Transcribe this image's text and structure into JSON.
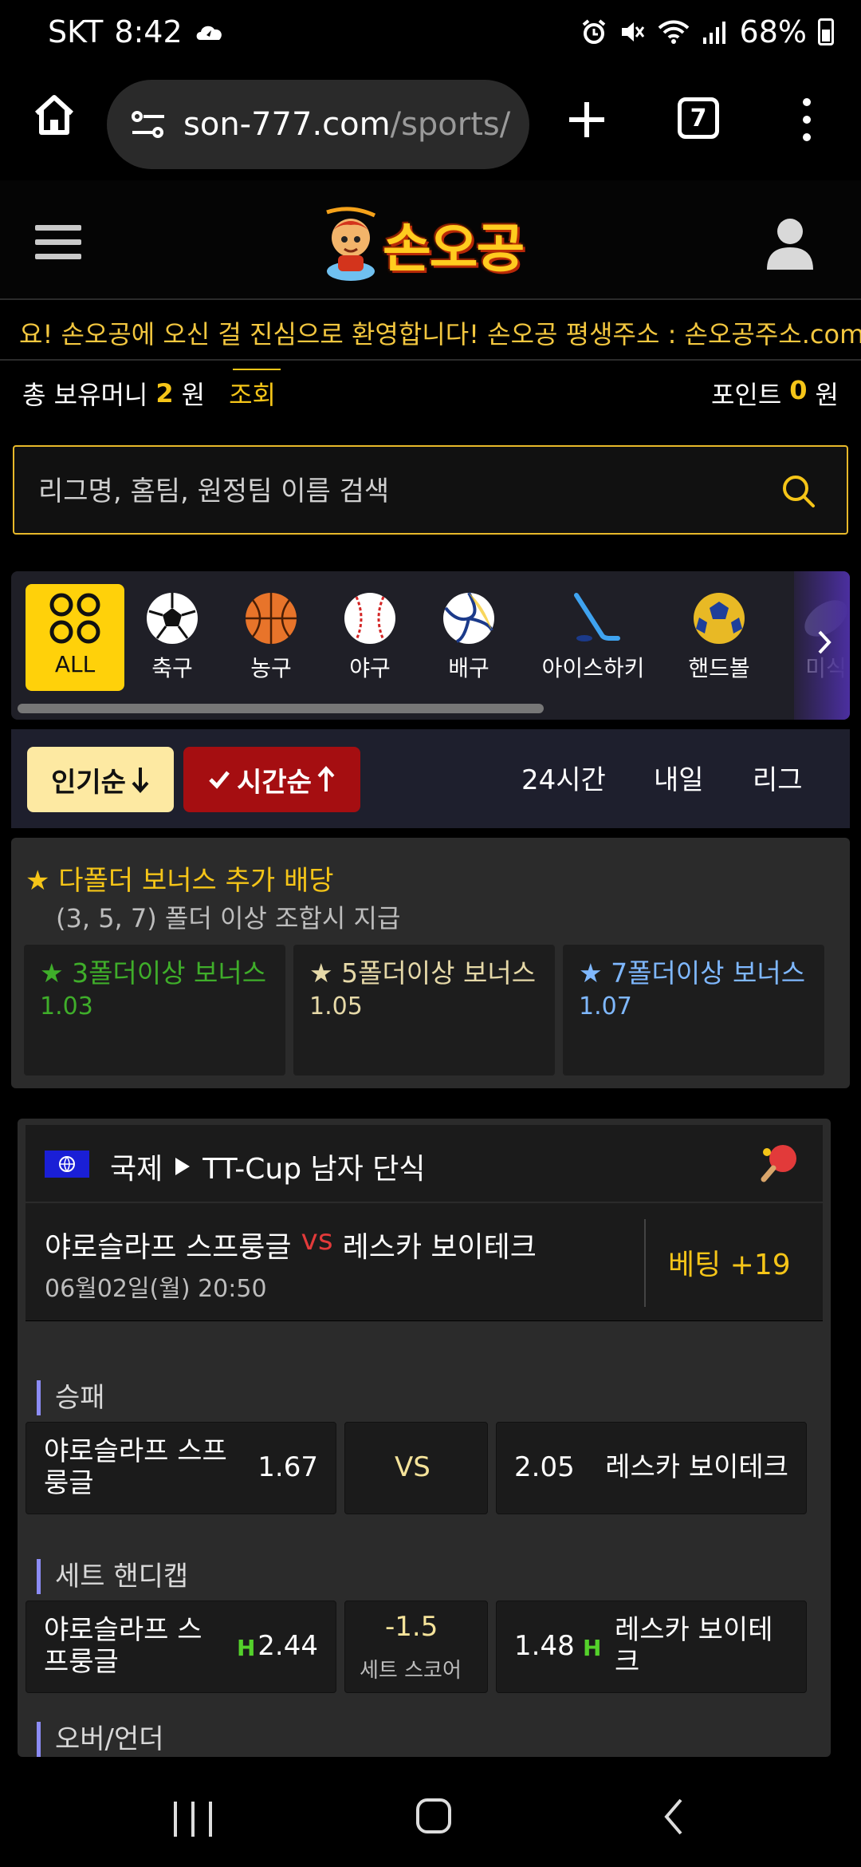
{
  "status": {
    "carrier": "SKT",
    "time": "8:42",
    "battery": "68%"
  },
  "browser": {
    "url_host": "son-777.com",
    "url_path": "/sports/",
    "tab_count": "7"
  },
  "site": {
    "logo_text": "손오공",
    "marquee": "요! 손오공에 오신 걸 진심으로 환영합니다! 손오공 평생주소 : 손오공주소.com  요"
  },
  "account": {
    "money_label": "총 보유머니",
    "money_value": "2",
    "money_unit": "원",
    "lookup_label": "조회",
    "points_label": "포인트",
    "points_value": "0",
    "points_unit": "원"
  },
  "search": {
    "placeholder": "리그명, 홈팀, 원정팀 이름 검색"
  },
  "sports": [
    {
      "label": "ALL",
      "icon": "all-icon"
    },
    {
      "label": "축구",
      "icon": "soccer-ball-icon"
    },
    {
      "label": "농구",
      "icon": "basketball-icon"
    },
    {
      "label": "야구",
      "icon": "baseball-icon"
    },
    {
      "label": "배구",
      "icon": "volleyball-icon"
    },
    {
      "label": "아이스하키",
      "icon": "hockey-stick-icon"
    },
    {
      "label": "핸드볼",
      "icon": "handball-icon"
    },
    {
      "label": "미식",
      "icon": "american-football-icon"
    }
  ],
  "sort": {
    "popular": "인기순",
    "time": "시간순",
    "links": [
      "24시간",
      "내일",
      "리그"
    ]
  },
  "bonus": {
    "title": "다폴더 보너스 추가 배당",
    "subtitle": "(3, 5, 7) 폴더 이상 조합시 지급",
    "cards": [
      {
        "label": "3폴더이상 보너스",
        "value": "1.03",
        "color": "#3fae2a"
      },
      {
        "label": "5폴더이상 보너스",
        "value": "1.05",
        "color": "#e6d9a8"
      },
      {
        "label": "7폴더이상 보너스",
        "value": "1.07",
        "color": "#7fb8ff"
      }
    ]
  },
  "match": {
    "region": "국제",
    "league": "TT-Cup 남자 단식",
    "home": "야로슬라프 스프룽글",
    "vs": "vs",
    "away": "레스카 보이테크",
    "datetime": "06월02일(월) 20:50",
    "bet_label": "베팅 +19",
    "markets": {
      "moneyline": {
        "label": "승패",
        "home_name": "야로슬라프 스프룽글",
        "home_odds": "1.67",
        "center": "VS",
        "away_odds": "2.05",
        "away_name": "레스카 보이테크"
      },
      "handicap": {
        "label": "세트 핸디캡",
        "home_name": "야로슬라프 스프룽글",
        "home_mark": "H",
        "home_odds": "2.44",
        "line": "-1.5",
        "line_sub": "세트 스코어",
        "away_odds": "1.48",
        "away_mark": "H",
        "away_name": "레스카 보이테크"
      },
      "overunder": {
        "label": "오버/언더"
      }
    }
  },
  "colors": {
    "accent": "#f5c518",
    "active_sort": "#a50e11",
    "popular_sort": "#fde9a2"
  }
}
